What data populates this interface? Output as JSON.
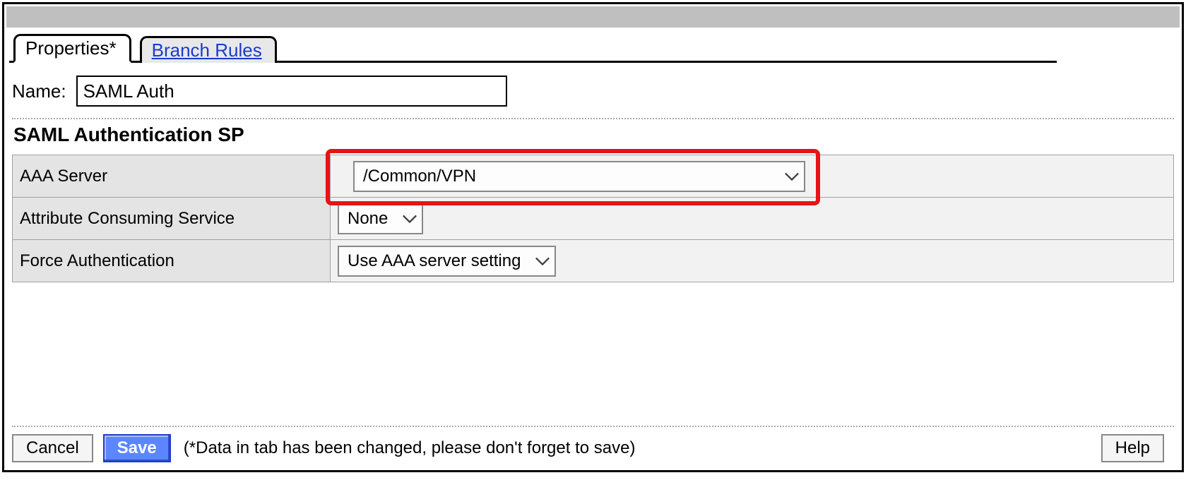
{
  "tabs": {
    "active": "Properties*",
    "inactive": "Branch Rules"
  },
  "name": {
    "label": "Name:",
    "value": "SAML Auth"
  },
  "section": {
    "title": "SAML Authentication SP"
  },
  "rows": {
    "aaa_server": {
      "label": "AAA Server",
      "value": "/Common/VPN"
    },
    "acs": {
      "label": "Attribute Consuming Service",
      "value": "None"
    },
    "force_auth": {
      "label": "Force Authentication",
      "value": "Use AAA server setting"
    }
  },
  "footer": {
    "cancel": "Cancel",
    "save": "Save",
    "note": "(*Data in tab has been changed, please don't forget to save)",
    "help": "Help"
  }
}
